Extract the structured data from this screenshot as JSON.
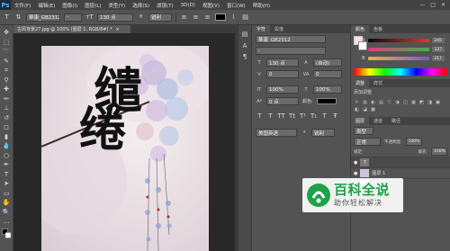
{
  "app": {
    "logo": "Ps"
  },
  "menubar": {
    "items": [
      "文件(F)",
      "编辑(E)",
      "图像(I)",
      "图层(L)",
      "类型(Y)",
      "选择(S)",
      "滤镜(T)",
      "3D(D)",
      "视图(V)",
      "窗口(W)",
      "帮助(H)"
    ],
    "window_controls": [
      "—",
      "□",
      "✕"
    ]
  },
  "options_bar": {
    "font_family": "華康_GB2312",
    "font_style": "-",
    "font_size": "130 点",
    "anti_alias": "锐利"
  },
  "document_tab": {
    "title": "古风背景27.jpg @ 100% (图层 1, RGB/8#) *",
    "close": "×"
  },
  "character_panel": {
    "tabs": [
      "字符",
      "段落"
    ],
    "font_family": "華康_GB2312",
    "font_style": "-",
    "font_size": "130 点",
    "leading": "(自动)",
    "kerning": "0",
    "tracking": "0",
    "vertical_scale": "100%",
    "horizontal_scale": "100%",
    "baseline_shift": "0 点",
    "color_label": "颜色:",
    "language": "美国英语",
    "anti_alias": "锐利"
  },
  "color_panel": {
    "tabs": [
      "颜色",
      "色板"
    ],
    "r": "245",
    "g": "227",
    "b": "217",
    "r_color": "#e0392f",
    "g_color": "#3bb54a",
    "b_color": "#7b55d6"
  },
  "adjustments_panel": {
    "tabs": [
      "调整",
      "样式"
    ],
    "add_label": "添加调整",
    "icons": [
      "☼",
      "▥",
      "◐",
      "▤",
      "▽",
      "◑",
      "◫",
      "▦",
      "◩",
      "◨",
      "▣",
      "◧",
      "◪",
      "▩"
    ]
  },
  "layers_panel": {
    "tabs": [
      "图层",
      "通道",
      "路径"
    ],
    "kind": "类型",
    "blend_mode": "正常",
    "opacity_label": "不透明度:",
    "opacity": "100%",
    "lock_label": "锁定:",
    "fill_label": "填充:",
    "fill": "100%",
    "layers": [
      {
        "name": "T",
        "visible": "●"
      },
      {
        "name": "图层 1",
        "visible": "●"
      },
      {
        "name": "背景",
        "visible": "●"
      }
    ]
  },
  "canvas": {
    "calligraphy_char1": "缱",
    "calligraphy_char2": "绻"
  },
  "watermark": {
    "title": "百科全说",
    "subtitle": "助你轻松解决"
  }
}
